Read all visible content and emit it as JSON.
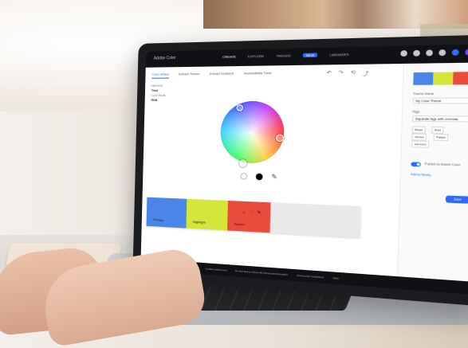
{
  "app": {
    "brand": "Adobe Color",
    "top_nav": [
      {
        "label": "CREATE",
        "active": true
      },
      {
        "label": "EXPLORE",
        "active": false
      },
      {
        "label": "TRENDS",
        "active": false
      },
      {
        "label": "NEW",
        "active": false
      },
      {
        "label": "LIBRARIES",
        "active": false
      }
    ]
  },
  "subtabs": [
    {
      "label": "Color Wheel",
      "active": true
    },
    {
      "label": "Extract Theme",
      "active": false
    },
    {
      "label": "Extract Gradient",
      "active": false
    },
    {
      "label": "Accessibility Tools",
      "active": false
    }
  ],
  "left_meta": {
    "harmony_label": "Harmony",
    "harmony_value": "Triad",
    "mode_label": "Color Mode",
    "mode_value": "RGB"
  },
  "palette": {
    "swatches": [
      {
        "color": "#4a86e8",
        "label": "Primary"
      },
      {
        "color": "#d4e63a",
        "label": "Highlight"
      },
      {
        "color": "#e74c3c",
        "label": "Accent"
      },
      {
        "color": "#e9e9e9",
        "label": ""
      },
      {
        "color": "#e9e9e9",
        "label": ""
      }
    ],
    "active_swatch_icons": "⌂ ◌ ✎"
  },
  "side_panel": {
    "swatches": [
      "#4a86e8",
      "#d4e63a",
      "#e74c3c"
    ],
    "theme_name_label": "Theme Name",
    "theme_name_value": "My Color Theme",
    "tags_label": "Tags",
    "tags_placeholder": "Separate tags with commas",
    "tags": [
      "Bright",
      "Bold",
      "Vibrant",
      "Palette",
      "Harmony"
    ],
    "toggle_label": "Publish to Adobe Color",
    "secondary_link": "Add to library",
    "save_label": "Save"
  },
  "footer": {
    "links": [
      "Language",
      "Privacy",
      "Terms of Use",
      "Cookie preferences",
      "Do Not Sell or Share My Personal Information",
      "Community Guidelines",
      "Help"
    ]
  }
}
